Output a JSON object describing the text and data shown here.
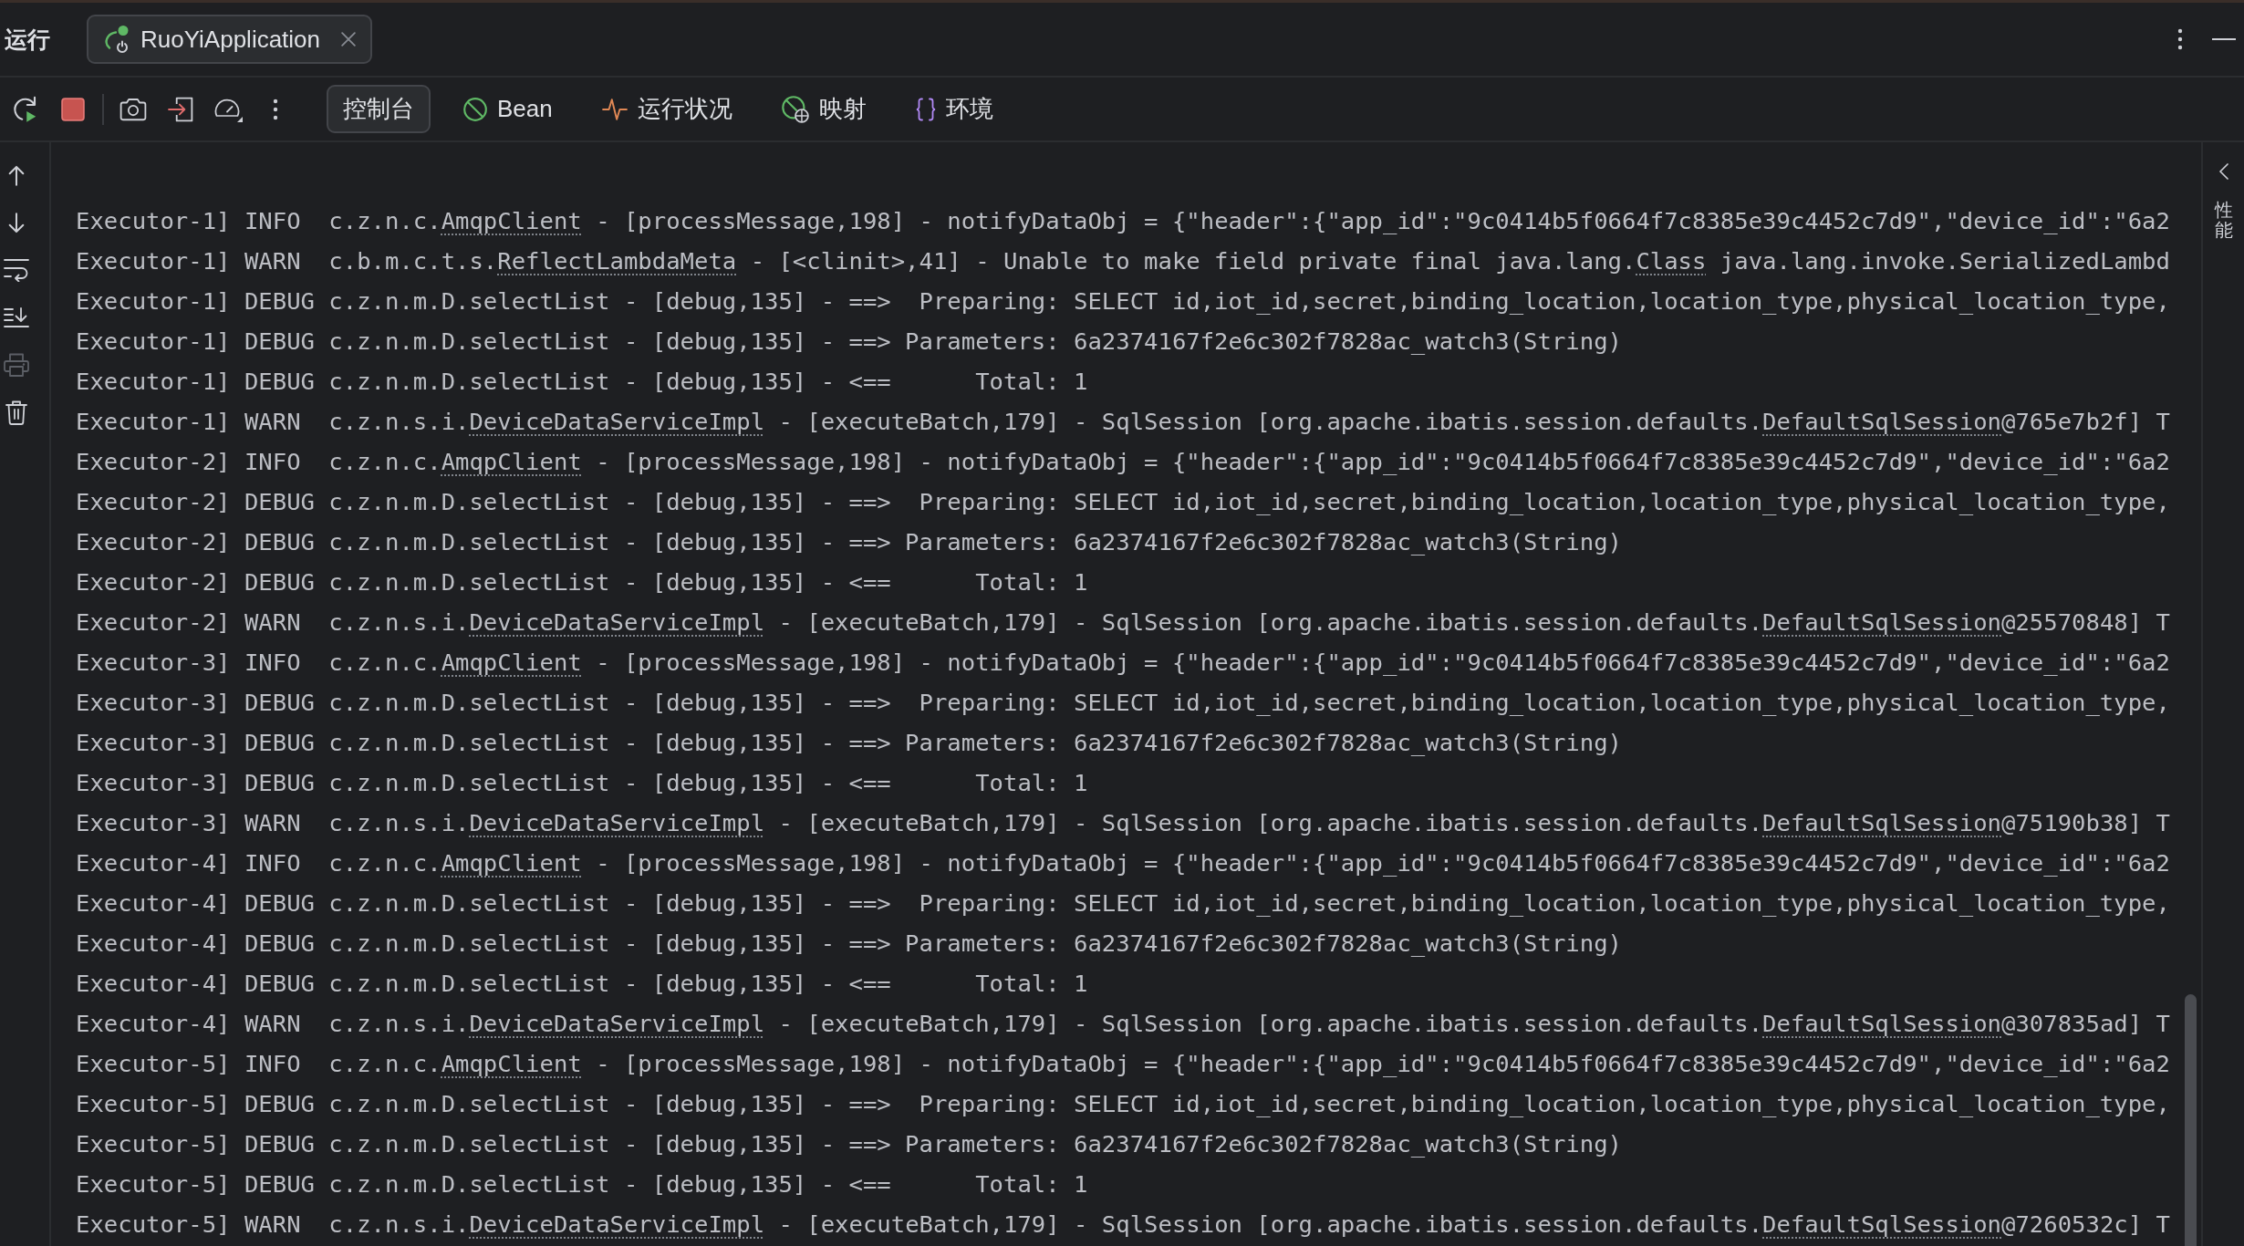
{
  "tool_window": {
    "title": "运行"
  },
  "run_tabs": [
    {
      "label": "RuoYiApplication",
      "selected": true
    }
  ],
  "view_tabs": [
    {
      "kind": "console",
      "label": "控制台",
      "selected": true
    },
    {
      "kind": "beans",
      "label": "Bean",
      "selected": false
    },
    {
      "kind": "health",
      "label": "运行状况",
      "selected": false
    },
    {
      "kind": "mappings",
      "label": "映射",
      "selected": false
    },
    {
      "kind": "environment",
      "label": "环境",
      "selected": false
    }
  ],
  "console_actions": [
    {
      "kind": "scroll_up",
      "disabled": false
    },
    {
      "kind": "scroll_down",
      "disabled": false
    },
    {
      "kind": "soft_wrap",
      "disabled": false
    },
    {
      "kind": "scroll_to_end",
      "disabled": false
    },
    {
      "kind": "print",
      "disabled": true
    },
    {
      "kind": "clear",
      "disabled": false
    }
  ],
  "console": {
    "lines": [
      {
        "segments": [
          {
            "kind": "text",
            "text": "Executor-1] INFO  c.z.n.c."
          },
          {
            "kind": "link",
            "text": "AmqpClient"
          },
          {
            "kind": "text",
            "text": " - [processMessage,198] - notifyDataObj = {\"header\":{\"app_id\":\"9c0414b5f0664f7c8385e39c4452c7d9\",\"device_id\":\"6a2"
          }
        ]
      },
      {
        "segments": [
          {
            "kind": "text",
            "text": "Executor-1] WARN  c.b.m.c.t.s."
          },
          {
            "kind": "link",
            "text": "ReflectLambdaMeta"
          },
          {
            "kind": "text",
            "text": " - [<clinit>,41] - Unable to make field private final java.lang."
          },
          {
            "kind": "link",
            "text": "Class"
          },
          {
            "kind": "text",
            "text": " java.lang.invoke.SerializedLambd"
          }
        ]
      },
      {
        "segments": [
          {
            "kind": "text",
            "text": "Executor-1] DEBUG c.z.n.m.D.selectList - [debug,135] - ==>  Preparing: SELECT id,iot_id,secret,binding_location,location_type,physical_location_type,"
          }
        ]
      },
      {
        "segments": [
          {
            "kind": "text",
            "text": "Executor-1] DEBUG c.z.n.m.D.selectList - [debug,135] - ==> Parameters: 6a2374167f2e6c302f7828ac_watch3(String)"
          }
        ]
      },
      {
        "segments": [
          {
            "kind": "text",
            "text": "Executor-1] DEBUG c.z.n.m.D.selectList - [debug,135] - <==      Total: 1"
          }
        ]
      },
      {
        "segments": [
          {
            "kind": "text",
            "text": "Executor-1] WARN  c.z.n.s.i."
          },
          {
            "kind": "link",
            "text": "DeviceDataServiceImpl"
          },
          {
            "kind": "text",
            "text": " - [executeBatch,179] - SqlSession [org.apache.ibatis.session.defaults."
          },
          {
            "kind": "link",
            "text": "DefaultSqlSession"
          },
          {
            "kind": "text",
            "text": "@765e7b2f] T"
          }
        ]
      },
      {
        "segments": [
          {
            "kind": "text",
            "text": "Executor-2] INFO  c.z.n.c."
          },
          {
            "kind": "link",
            "text": "AmqpClient"
          },
          {
            "kind": "text",
            "text": " - [processMessage,198] - notifyDataObj = {\"header\":{\"app_id\":\"9c0414b5f0664f7c8385e39c4452c7d9\",\"device_id\":\"6a2"
          }
        ]
      },
      {
        "segments": [
          {
            "kind": "text",
            "text": "Executor-2] DEBUG c.z.n.m.D.selectList - [debug,135] - ==>  Preparing: SELECT id,iot_id,secret,binding_location,location_type,physical_location_type,"
          }
        ]
      },
      {
        "segments": [
          {
            "kind": "text",
            "text": "Executor-2] DEBUG c.z.n.m.D.selectList - [debug,135] - ==> Parameters: 6a2374167f2e6c302f7828ac_watch3(String)"
          }
        ]
      },
      {
        "segments": [
          {
            "kind": "text",
            "text": "Executor-2] DEBUG c.z.n.m.D.selectList - [debug,135] - <==      Total: 1"
          }
        ]
      },
      {
        "segments": [
          {
            "kind": "text",
            "text": "Executor-2] WARN  c.z.n.s.i."
          },
          {
            "kind": "link",
            "text": "DeviceDataServiceImpl"
          },
          {
            "kind": "text",
            "text": " - [executeBatch,179] - SqlSession [org.apache.ibatis.session.defaults."
          },
          {
            "kind": "link",
            "text": "DefaultSqlSession"
          },
          {
            "kind": "text",
            "text": "@25570848] T"
          }
        ]
      },
      {
        "segments": [
          {
            "kind": "text",
            "text": "Executor-3] INFO  c.z.n.c."
          },
          {
            "kind": "link",
            "text": "AmqpClient"
          },
          {
            "kind": "text",
            "text": " - [processMessage,198] - notifyDataObj = {\"header\":{\"app_id\":\"9c0414b5f0664f7c8385e39c4452c7d9\",\"device_id\":\"6a2"
          }
        ]
      },
      {
        "segments": [
          {
            "kind": "text",
            "text": "Executor-3] DEBUG c.z.n.m.D.selectList - [debug,135] - ==>  Preparing: SELECT id,iot_id,secret,binding_location,location_type,physical_location_type,"
          }
        ]
      },
      {
        "segments": [
          {
            "kind": "text",
            "text": "Executor-3] DEBUG c.z.n.m.D.selectList - [debug,135] - ==> Parameters: 6a2374167f2e6c302f7828ac_watch3(String)"
          }
        ]
      },
      {
        "segments": [
          {
            "kind": "text",
            "text": "Executor-3] DEBUG c.z.n.m.D.selectList - [debug,135] - <==      Total: 1"
          }
        ]
      },
      {
        "segments": [
          {
            "kind": "text",
            "text": "Executor-3] WARN  c.z.n.s.i."
          },
          {
            "kind": "link",
            "text": "DeviceDataServiceImpl"
          },
          {
            "kind": "text",
            "text": " - [executeBatch,179] - SqlSession [org.apache.ibatis.session.defaults."
          },
          {
            "kind": "link",
            "text": "DefaultSqlSession"
          },
          {
            "kind": "text",
            "text": "@75190b38] T"
          }
        ]
      },
      {
        "segments": [
          {
            "kind": "text",
            "text": "Executor-4] INFO  c.z.n.c."
          },
          {
            "kind": "link",
            "text": "AmqpClient"
          },
          {
            "kind": "text",
            "text": " - [processMessage,198] - notifyDataObj = {\"header\":{\"app_id\":\"9c0414b5f0664f7c8385e39c4452c7d9\",\"device_id\":\"6a2"
          }
        ]
      },
      {
        "segments": [
          {
            "kind": "text",
            "text": "Executor-4] DEBUG c.z.n.m.D.selectList - [debug,135] - ==>  Preparing: SELECT id,iot_id,secret,binding_location,location_type,physical_location_type,"
          }
        ]
      },
      {
        "segments": [
          {
            "kind": "text",
            "text": "Executor-4] DEBUG c.z.n.m.D.selectList - [debug,135] - ==> Parameters: 6a2374167f2e6c302f7828ac_watch3(String)"
          }
        ]
      },
      {
        "segments": [
          {
            "kind": "text",
            "text": "Executor-4] DEBUG c.z.n.m.D.selectList - [debug,135] - <==      Total: 1"
          }
        ]
      },
      {
        "segments": [
          {
            "kind": "text",
            "text": "Executor-4] WARN  c.z.n.s.i."
          },
          {
            "kind": "link",
            "text": "DeviceDataServiceImpl"
          },
          {
            "kind": "text",
            "text": " - [executeBatch,179] - SqlSession [org.apache.ibatis.session.defaults."
          },
          {
            "kind": "link",
            "text": "DefaultSqlSession"
          },
          {
            "kind": "text",
            "text": "@307835ad] T"
          }
        ]
      },
      {
        "segments": [
          {
            "kind": "text",
            "text": "Executor-5] INFO  c.z.n.c."
          },
          {
            "kind": "link",
            "text": "AmqpClient"
          },
          {
            "kind": "text",
            "text": " - [processMessage,198] - notifyDataObj = {\"header\":{\"app_id\":\"9c0414b5f0664f7c8385e39c4452c7d9\",\"device_id\":\"6a2"
          }
        ]
      },
      {
        "segments": [
          {
            "kind": "text",
            "text": "Executor-5] DEBUG c.z.n.m.D.selectList - [debug,135] - ==>  Preparing: SELECT id,iot_id,secret,binding_location,location_type,physical_location_type,"
          }
        ]
      },
      {
        "segments": [
          {
            "kind": "text",
            "text": "Executor-5] DEBUG c.z.n.m.D.selectList - [debug,135] - ==> Parameters: 6a2374167f2e6c302f7828ac_watch3(String)"
          }
        ]
      },
      {
        "segments": [
          {
            "kind": "text",
            "text": "Executor-5] DEBUG c.z.n.m.D.selectList - [debug,135] - <==      Total: 1"
          }
        ]
      },
      {
        "segments": [
          {
            "kind": "text",
            "text": "Executor-5] WARN  c.z.n.s.i."
          },
          {
            "kind": "link",
            "text": "DeviceDataServiceImpl"
          },
          {
            "kind": "text",
            "text": " - [executeBatch,179] - SqlSession [org.apache.ibatis.session.defaults."
          },
          {
            "kind": "link",
            "text": "DefaultSqlSession"
          },
          {
            "kind": "text",
            "text": "@7260532c] T"
          }
        ]
      }
    ]
  },
  "side_panel": {
    "label": "性能"
  }
}
